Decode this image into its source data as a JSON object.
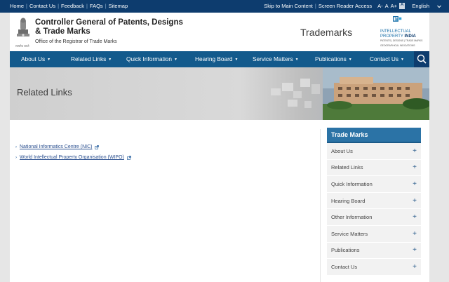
{
  "topbar": {
    "links": [
      "Home",
      "Contact Us",
      "Feedback",
      "FAQs",
      "Sitemap"
    ],
    "skip": "Skip to Main Content",
    "reader": "Screen Reader Access",
    "font_small": "A-",
    "font_normal": "A",
    "font_large": "A+",
    "contrast": "A",
    "language": "English"
  },
  "header": {
    "org_title": "Controller General of Patents, Designs & Trade Marks",
    "org_sub": "Office of the Registrar of Trade Marks",
    "emblem_caption": "सत्यमेव जयते",
    "section": "Trademarks",
    "ipi_line1": "INTELLECTUAL",
    "ipi_line2": "PROPERTY",
    "ipi_line3": "INDIA",
    "ipi_small": "PATENTS | DESIGNS | TRADE MARKS GEOGRAPHICAL INDICATIONS"
  },
  "nav": {
    "items": [
      "About Us",
      "Related Links",
      "Quick Information",
      "Hearing Board",
      "Service Matters",
      "Publications",
      "Contact Us"
    ],
    "search_icon": "search-icon"
  },
  "banner": {
    "title": "Related Links"
  },
  "links": [
    "National Informatics Centre (NIC)",
    "World Intellectual Property Organisation (WIPO)"
  ],
  "sidebar": {
    "heading": "Trade Marks",
    "items": [
      "About Us",
      "Related Links",
      "Quick Information",
      "Hearing Board",
      "Other Information",
      "Service Matters",
      "Publications",
      "Contact Us"
    ],
    "plus": "+"
  },
  "colors": {
    "topbar": "#0d3c6e",
    "nav": "#135a8c",
    "sidebar_head": "#2b73a6"
  }
}
